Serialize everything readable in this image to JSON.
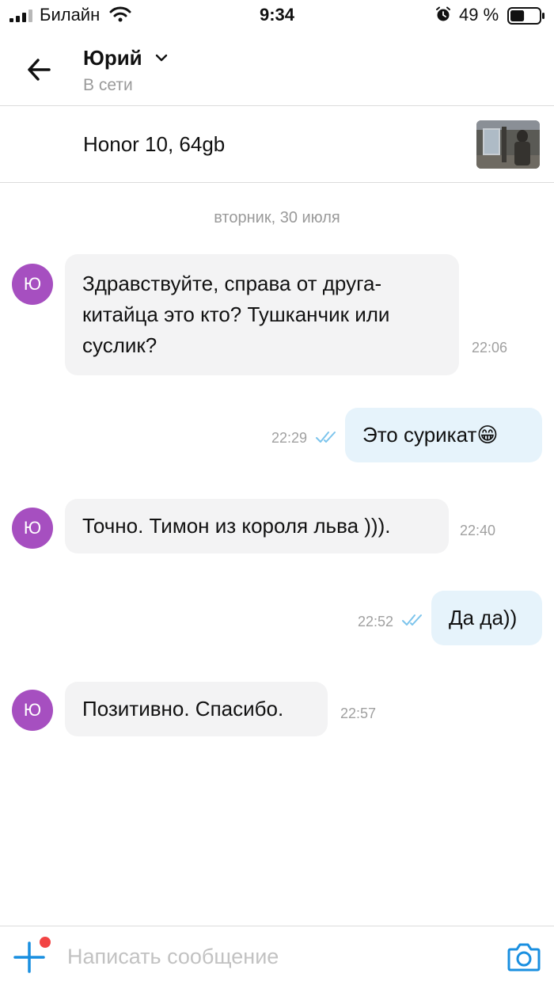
{
  "status_bar": {
    "carrier": "Билайн",
    "time": "9:34",
    "battery_percent": "49 %",
    "battery_level": 0.49
  },
  "header": {
    "contact_name": "Юрий",
    "contact_status": "В сети"
  },
  "listing": {
    "title": "Honor 10, 64gb"
  },
  "chat": {
    "date_separator": "вторник, 30 июля",
    "avatar_letter": "Ю",
    "messages": [
      {
        "direction": "in",
        "text": "Здравствуйте, справа от друга-китайца это кто? Тушканчик или суслик?",
        "time": "22:06"
      },
      {
        "direction": "out",
        "text": "Это сурикат😁",
        "time": "22:29",
        "read": true
      },
      {
        "direction": "in",
        "text": "Точно. Тимон из короля льва ))).",
        "time": "22:40"
      },
      {
        "direction": "out",
        "text": "Да да))",
        "time": "22:52",
        "read": true
      },
      {
        "direction": "in",
        "text": "Позитивно. Спасибо.",
        "time": "22:57"
      }
    ]
  },
  "composer": {
    "placeholder": "Написать сообщение"
  },
  "colors": {
    "accent": "#1a8fe0",
    "avatar": "#a64fc0",
    "incoming_bubble": "#f3f3f4",
    "outgoing_bubble": "#e6f3fb",
    "read_check": "#7cc4ec",
    "notification_dot": "#f24444"
  },
  "icons": [
    "signal-icon",
    "wifi-icon",
    "alarm-icon",
    "battery-icon",
    "back-arrow-icon",
    "chevron-down-icon",
    "double-check-icon",
    "plus-icon",
    "camera-icon"
  ]
}
